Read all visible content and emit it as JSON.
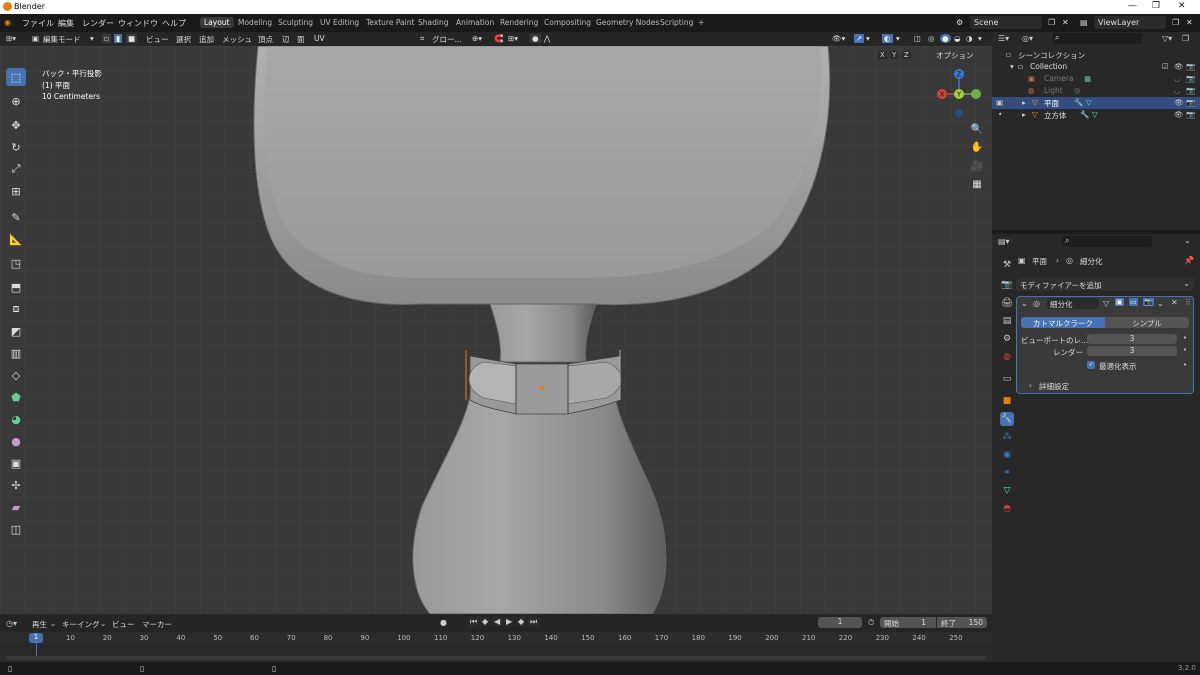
{
  "window": {
    "title": "Blender",
    "min": "—",
    "max": "❐",
    "close": "✕"
  },
  "menu": [
    "ファイル",
    "編集",
    "レンダー",
    "ウィンドウ",
    "ヘルプ"
  ],
  "workspaces": [
    "Layout",
    "Modeling",
    "Sculpting",
    "UV Editing",
    "Texture Paint",
    "Shading",
    "Animation",
    "Rendering",
    "Compositing",
    "Geometry Nodes",
    "Scripting"
  ],
  "workspace_add": "+",
  "scene": {
    "name": "Scene",
    "view_layer": "ViewLayer"
  },
  "header3d": {
    "mode": "編集モード",
    "menus": [
      "ビュー",
      "選択",
      "追加",
      "メッシュ",
      "頂点",
      "辺",
      "面",
      "UV"
    ],
    "orientation": "グロー...",
    "axes": [
      "X",
      "Y",
      "Z"
    ],
    "options": "オプション"
  },
  "viewport": {
    "view_name": "バック・平行投影",
    "object": "(1) 平面",
    "scale": "10 Centimeters",
    "gizmo": {
      "x": "X",
      "y": "Y",
      "z": "Z"
    },
    "bg_color": "#393939",
    "model_color": "#8a8a8a",
    "select_color": "#e87d0d"
  },
  "outliner": {
    "search_placeholder": "",
    "root": "シーンコレクション",
    "collection": "Collection",
    "items": [
      {
        "label": "Camera",
        "selected": false
      },
      {
        "label": "Light",
        "selected": false
      },
      {
        "label": "平面",
        "selected": true
      },
      {
        "label": "立方体",
        "selected": false
      }
    ]
  },
  "properties": {
    "breadcrumb_object": "平面",
    "breadcrumb_modifier": "細分化",
    "add_modifier": "モディファイアーを追加",
    "modifier_name": "細分化",
    "tab_catmull": "カトマルクラーク",
    "tab_simple": "シンプル",
    "viewport_levels_label": "ビューポートのレ...",
    "viewport_levels_value": "3",
    "render_label": "レンダー",
    "render_value": "3",
    "optimal_display_label": "最適化表示",
    "optimal_display_checked": true,
    "advanced_label": "詳細設定",
    "accent": "#4772b3"
  },
  "timeline": {
    "menus": [
      "再生",
      "キーイング",
      "ビュー",
      "マーカー"
    ],
    "current_frame": "1",
    "start_label": "開始",
    "start_value": "1",
    "end_label": "終了",
    "end_value": "150",
    "ticks": [
      "10",
      "20",
      "30",
      "40",
      "50",
      "60",
      "70",
      "80",
      "90",
      "100",
      "110",
      "120",
      "130",
      "140",
      "150",
      "160",
      "170",
      "180",
      "190",
      "200",
      "210",
      "220",
      "230",
      "240",
      "250"
    ],
    "playhead": "1"
  },
  "status": {
    "version": "3.2.0"
  }
}
